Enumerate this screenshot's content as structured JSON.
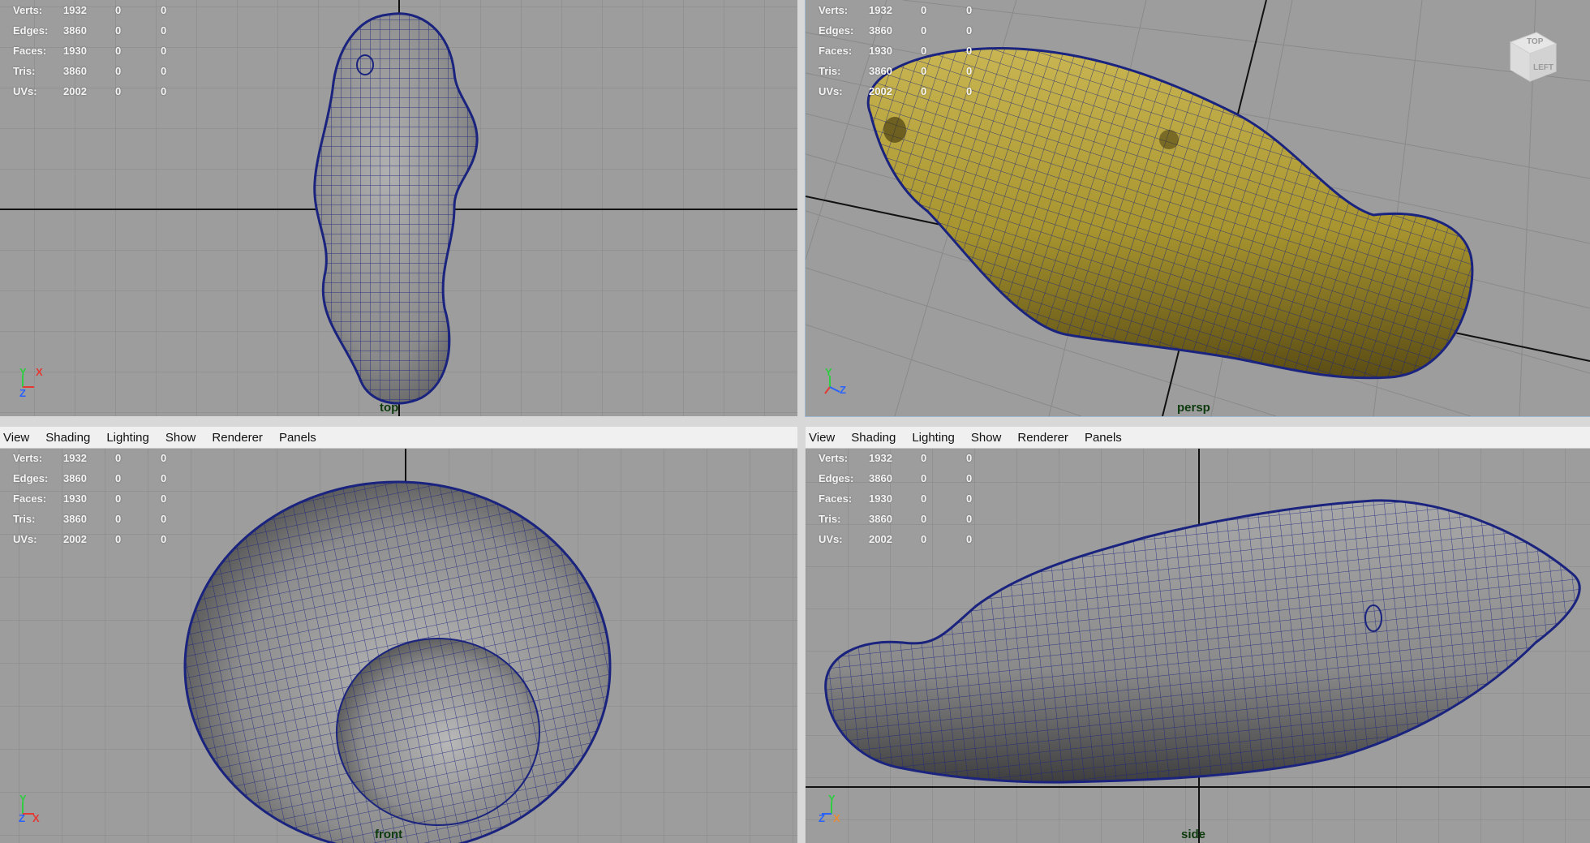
{
  "menu": [
    "View",
    "Shading",
    "Lighting",
    "Show",
    "Renderer",
    "Panels"
  ],
  "stats": [
    {
      "label": "Verts:",
      "value": "1932",
      "a": "0",
      "b": "0"
    },
    {
      "label": "Edges:",
      "value": "3860",
      "a": "0",
      "b": "0"
    },
    {
      "label": "Faces:",
      "value": "1930",
      "a": "0",
      "b": "0"
    },
    {
      "label": "Tris:",
      "value": "3860",
      "a": "0",
      "b": "0"
    },
    {
      "label": "UVs:",
      "value": "2002",
      "a": "0",
      "b": "0"
    }
  ],
  "cameras": {
    "top": "top",
    "persp": "persp",
    "front": "front",
    "side": "side"
  },
  "axes": {
    "x": "X",
    "y": "Y",
    "z": "Z"
  },
  "viewcube": {
    "top": "TOP",
    "left": "LEFT"
  },
  "colors": {
    "viewport_bg": "#9d9d9d",
    "grid": "#888888",
    "wire": "#1a237e",
    "mesh_gray": "#8f8f8f",
    "mesh_textured": "#b3a13c",
    "axis_x": "#e53935",
    "axis_y": "#2ecc40",
    "axis_z": "#2962ff"
  }
}
